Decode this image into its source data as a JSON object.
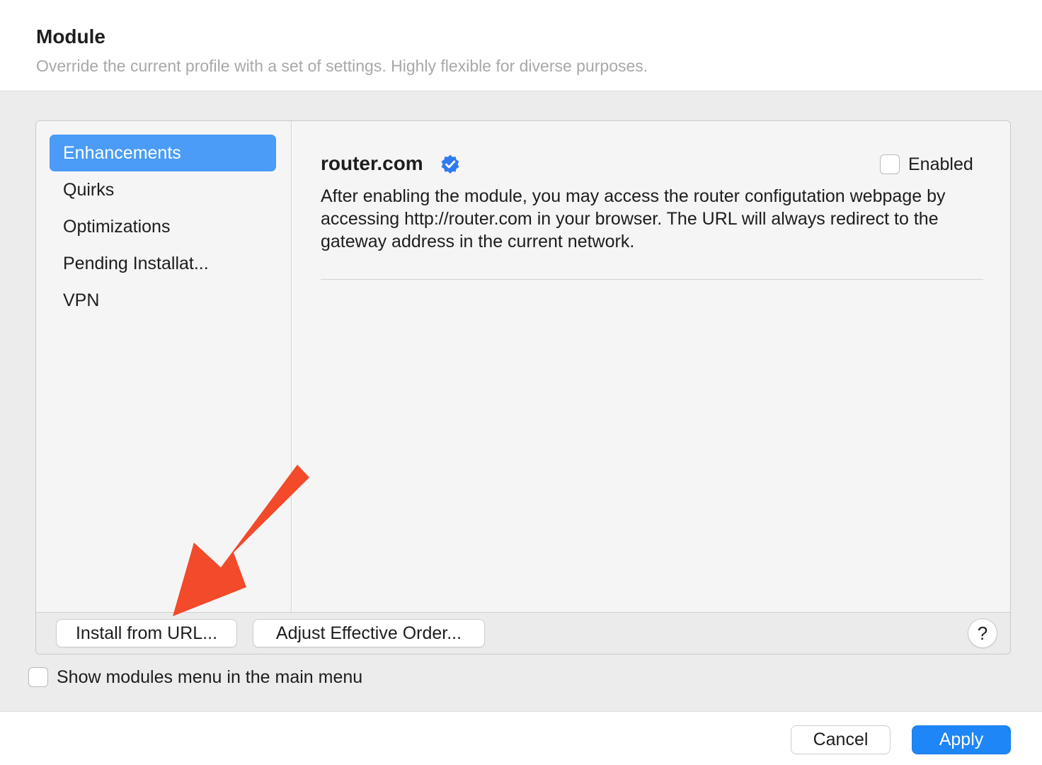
{
  "header": {
    "title": "Module",
    "subtitle": "Override the current profile with a set of settings. Highly flexible for diverse purposes."
  },
  "sidebar": {
    "items": [
      {
        "label": "Enhancements",
        "selected": true
      },
      {
        "label": "Quirks",
        "selected": false
      },
      {
        "label": "Optimizations",
        "selected": false
      },
      {
        "label": "Pending Installat...",
        "selected": false
      },
      {
        "label": "VPN",
        "selected": false
      }
    ]
  },
  "module": {
    "name": "router.com",
    "badge_icon": "verified-badge-icon",
    "enabled_label": "Enabled",
    "enabled": false,
    "description": "After enabling the module, you may access the router configutation webpage by accessing http://router.com in your browser. The URL will always redirect to the gateway address in the current network."
  },
  "toolbar": {
    "install_label": "Install from URL...",
    "order_label": "Adjust Effective Order...",
    "help_label": "?"
  },
  "options": {
    "show_menu_label": "Show modules menu in the main menu",
    "show_menu_checked": false
  },
  "footer": {
    "cancel_label": "Cancel",
    "apply_label": "Apply"
  },
  "colors": {
    "accent": "#1e86f7",
    "selection": "#4a9cf7",
    "annotation_arrow": "#f24a2a",
    "verified_badge": "#2f7bf0"
  }
}
